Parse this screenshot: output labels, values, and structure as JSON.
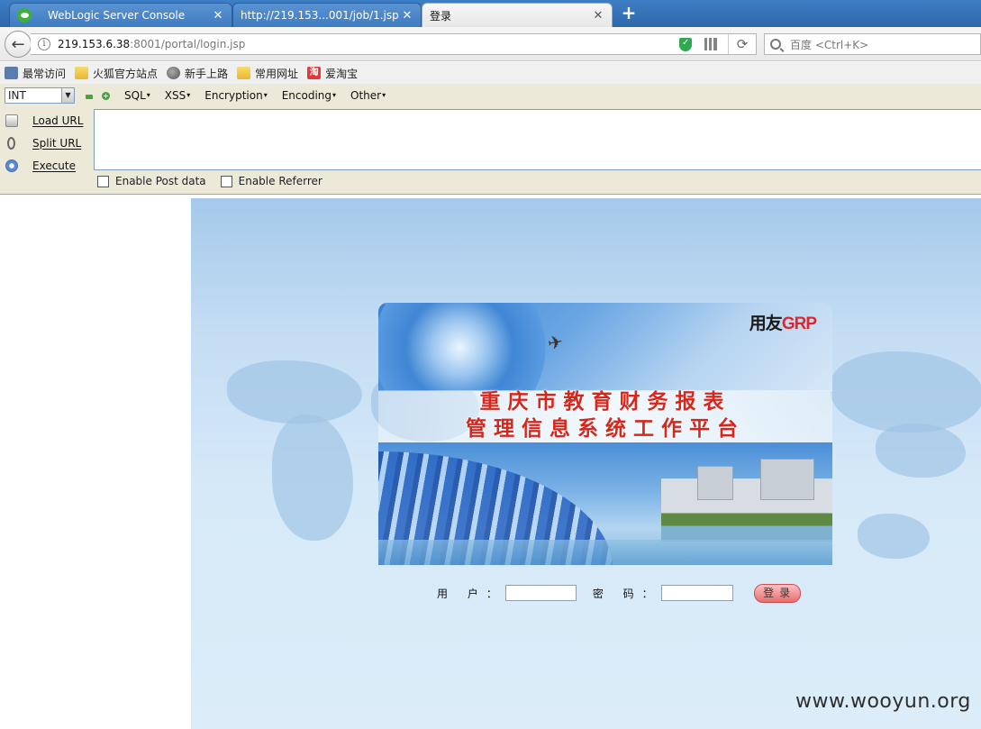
{
  "browser": {
    "tabs": [
      {
        "label": "WebLogic Server Console",
        "icon": "wechat-icon",
        "active": false
      },
      {
        "label": "http://219.153...001/job/1.jsp",
        "active": false
      },
      {
        "label": "登录",
        "active": true
      }
    ],
    "close_glyph": "✕",
    "new_tab_glyph": "+",
    "url_host": "219.153.6.38",
    "url_rest": ":8001/portal/login.jsp",
    "search_placeholder": "百度 <Ctrl+K>",
    "bookmarks": [
      {
        "label": "最常访问",
        "icon": "gear-icon"
      },
      {
        "label": "火狐官方站点",
        "icon": "folder-icon"
      },
      {
        "label": "新手上路",
        "icon": "globe-icon"
      },
      {
        "label": "常用网址",
        "icon": "folder-icon"
      },
      {
        "label": "爱淘宝",
        "icon": "taobao-icon",
        "icon_text": "淘"
      }
    ]
  },
  "hackbar": {
    "type_select": "INT",
    "menus": [
      "SQL",
      "XSS",
      "Encryption",
      "Encoding",
      "Other"
    ],
    "actions": [
      "Load URL",
      "Split URL",
      "Execute"
    ],
    "checkboxes": [
      "Enable Post data",
      "Enable Referrer"
    ]
  },
  "page": {
    "brand_prefix": "用友",
    "brand_suffix": "GRP",
    "title_line1": "重庆市教育财务报表",
    "title_line2": "管理信息系统工作平台",
    "user_label": "用 户：",
    "password_label": "密 码：",
    "login_button": "登录"
  },
  "watermark": "www.wooyun.org",
  "colors": {
    "title_red": "#d9261c",
    "brand_red": "#e0262d",
    "tabstrip_blue": "#3d7ec5",
    "hackbar_bg": "#ece9d8"
  }
}
